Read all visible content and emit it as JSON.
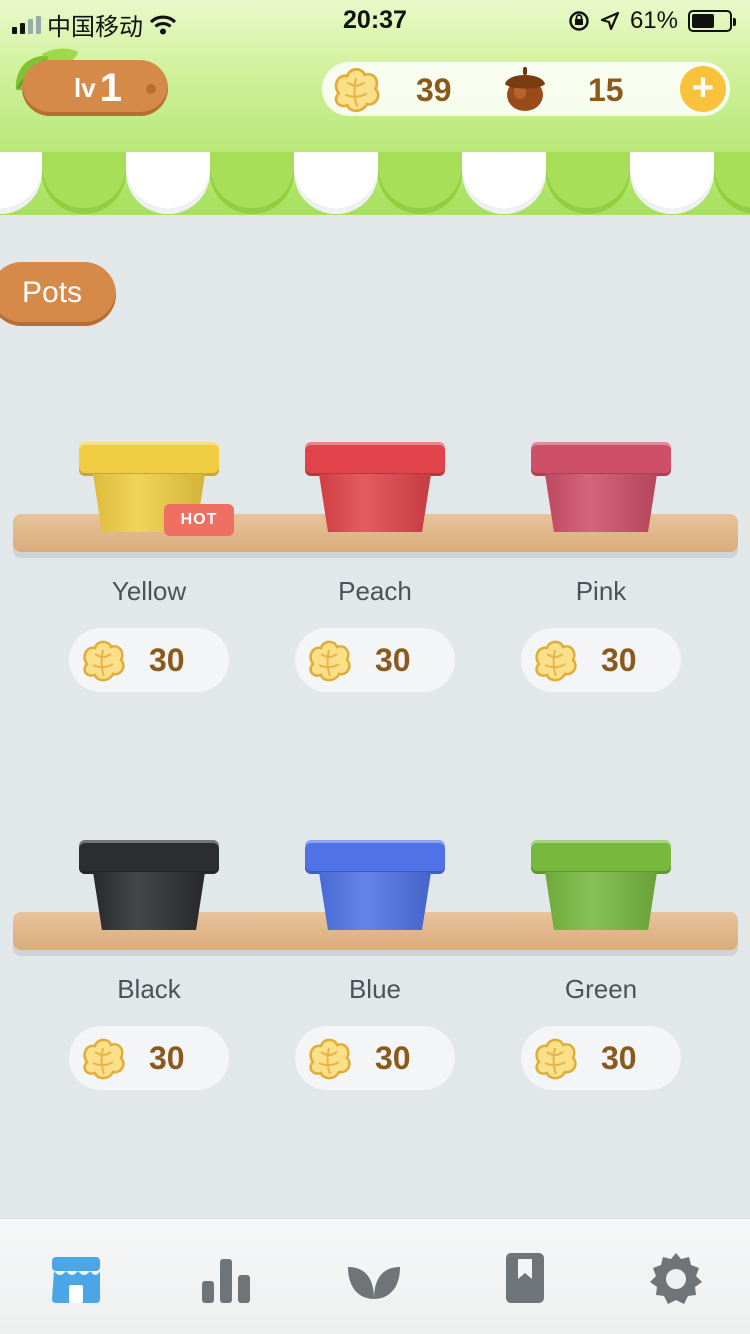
{
  "status_bar": {
    "carrier": "中国移动",
    "time": "20:37",
    "battery": "61%"
  },
  "header": {
    "level_prefix": "lv",
    "level": "1",
    "seeds": "39",
    "acorns": "15"
  },
  "section_title": "Pots",
  "hot_badge": "HOT",
  "pots": [
    {
      "name": "Yellow",
      "price": "30",
      "color": "#f0cc42"
    },
    {
      "name": "Peach",
      "price": "30",
      "color": "#e0444a"
    },
    {
      "name": "Pink",
      "price": "30",
      "color": "#cf4f68"
    },
    {
      "name": "Black",
      "price": "30",
      "color": "#2b2d30"
    },
    {
      "name": "Blue",
      "price": "30",
      "color": "#4f73e6"
    },
    {
      "name": "Green",
      "price": "30",
      "color": "#77b83f"
    }
  ],
  "tabbar": [
    "store-icon",
    "chart-icon",
    "leaf-icon",
    "bookmark-icon",
    "gear-icon"
  ],
  "colors": {
    "accent": "#d68a4a",
    "header_green": "#a6e05d",
    "active_tab": "#4aa6e6"
  }
}
